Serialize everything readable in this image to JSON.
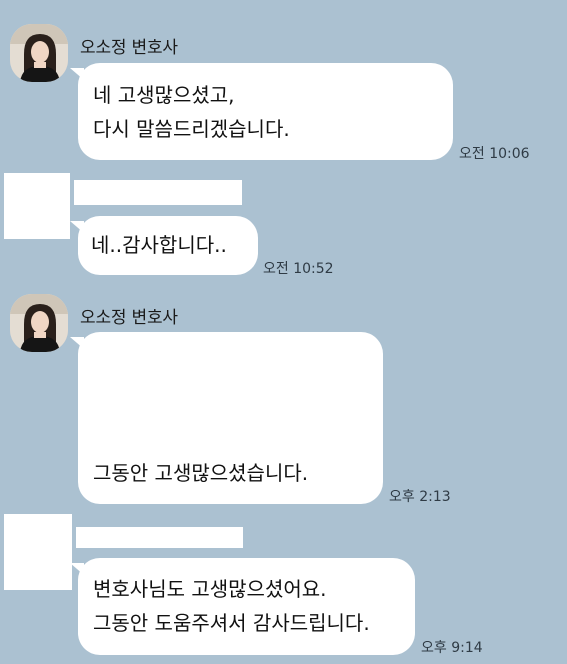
{
  "messages": [
    {
      "sender": "오소정 변호사",
      "lines": [
        "네 고생많으셨고,",
        "다시 말씀드리겠습니다."
      ],
      "time": "오전 10:06"
    },
    {
      "lines": [
        "네..감사합니다.."
      ],
      "time": "오전 10:52"
    },
    {
      "sender": "오소정 변호사",
      "lines": [
        "그동안 고생많으셨습니다."
      ],
      "time": "오후 2:13"
    },
    {
      "lines": [
        "변호사님도 고생많으셨어요.",
        "그동안 도움주셔서 감사드립니다."
      ],
      "time": "오후 9:14"
    }
  ],
  "colors": {
    "background": "#abc1d1",
    "bubble": "#ffffff"
  }
}
